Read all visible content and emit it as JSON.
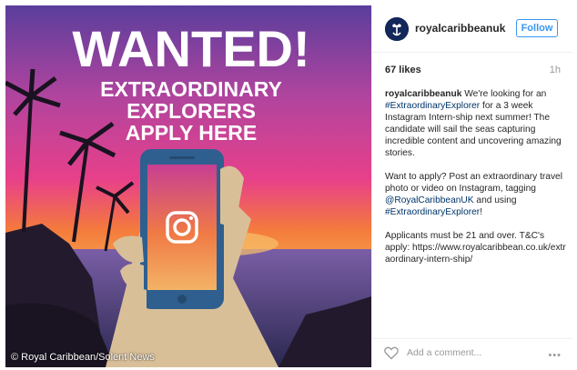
{
  "post": {
    "image": {
      "headline": "WANTED!",
      "subline_1": "EXTRAORDINARY",
      "subline_2": "EXPLORERS",
      "subline_3": "APPLY HERE",
      "phone_icon": "instagram-icon"
    },
    "credit": "© Royal Caribbean/Solent News",
    "header": {
      "username": "royalcaribbeanuk",
      "follow_label": "Follow",
      "avatar_icon": "royal-caribbean-crown-anchor-icon"
    },
    "meta": {
      "likes": "67 likes",
      "time": "1h"
    },
    "caption": {
      "username": "royalcaribbeanuk",
      "p1_a": "We're looking for an",
      "p1_tag": "#ExtraordinaryExplorer",
      "p1_b": "for a 3 week Instagram Intern-ship next summer! The candidate will sail the seas capturing incredible content and uncovering amazing stories.",
      "p2_a": "Want to apply? Post an extraordinary travel photo or video on Instagram, tagging",
      "p2_mention": "@RoyalCaribbeanUK",
      "p2_b": "and using",
      "p2_tag": "#ExtraordinaryExplorer",
      "p2_c": "!",
      "p3_a": "Applicants must be 21 and over. T&C's apply:",
      "p3_url": "https://www.royalcaribbean.co.uk/extraordinary-intern-ship/"
    },
    "footer": {
      "comment_placeholder": "Add a comment...",
      "like_icon": "heart-icon",
      "more_icon": "more-options-icon"
    }
  },
  "colors": {
    "accent_blue": "#3897f0",
    "hashtag": "#003569",
    "brand_navy": "#12275a",
    "sky_pink": "#e8408a",
    "sky_orange": "#f47a3c",
    "phone_blue": "#2f5f8f"
  }
}
